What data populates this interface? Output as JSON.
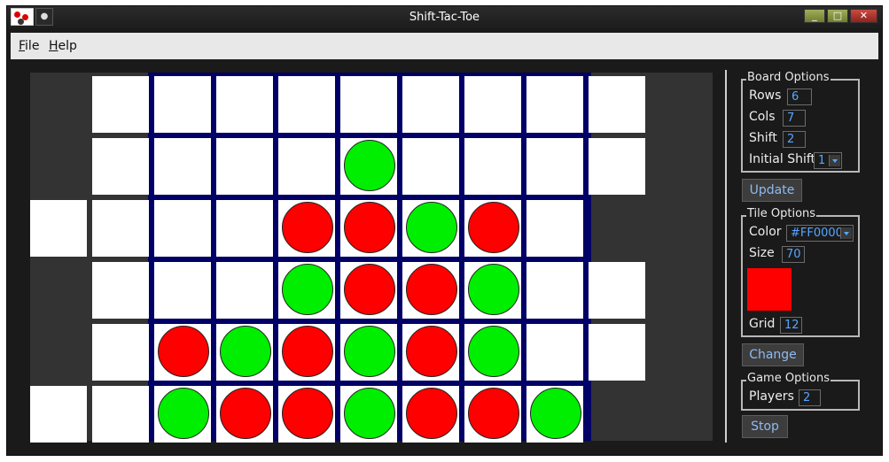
{
  "window": {
    "title": "Shift-Tac-Toe",
    "buttons": {
      "minimize": "_",
      "maximize": "□",
      "close": "✕"
    }
  },
  "menu": {
    "items": [
      {
        "label": "File",
        "accel": "F",
        "rest": "ile"
      },
      {
        "label": "Help",
        "accel": "H",
        "rest": "elp"
      }
    ]
  },
  "board": {
    "rows": 6,
    "visible_cols": 9,
    "grid_cols": 7,
    "row_offsets": [
      1,
      1,
      0,
      1,
      1,
      0
    ],
    "colors": {
      "red": "#FF0000",
      "green": "#00EE00",
      "grid": "#000066",
      "frame": "#333333"
    },
    "pieces": [
      [
        null,
        null,
        null,
        null,
        null,
        null,
        null
      ],
      [
        null,
        null,
        null,
        "green",
        null,
        null,
        null
      ],
      [
        null,
        null,
        "red",
        "red",
        "green",
        "red",
        null
      ],
      [
        null,
        null,
        "green",
        "red",
        "red",
        "green",
        null
      ],
      [
        "red",
        "green",
        "red",
        "green",
        "red",
        "green",
        null
      ],
      [
        "green",
        "red",
        "red",
        "green",
        "red",
        "red",
        "green"
      ]
    ]
  },
  "board_options": {
    "title": "Board Options",
    "rows_label": "Rows",
    "rows_value": "6",
    "cols_label": "Cols",
    "cols_value": "7",
    "shift_label": "Shift",
    "shift_value": "2",
    "initial_shift_label": "Initial Shift",
    "initial_shift_value": "1",
    "update_button": "Update"
  },
  "tile_options": {
    "title": "Tile Options",
    "color_label": "Color",
    "color_value": "#FF0000",
    "size_label": "Size",
    "size_value": "70",
    "grid_label": "Grid",
    "grid_value": "12",
    "swatch_color": "#FF0000",
    "change_button": "Change"
  },
  "game_options": {
    "title": "Game Options",
    "players_label": "Players",
    "players_value": "2",
    "stop_button": "Stop"
  }
}
